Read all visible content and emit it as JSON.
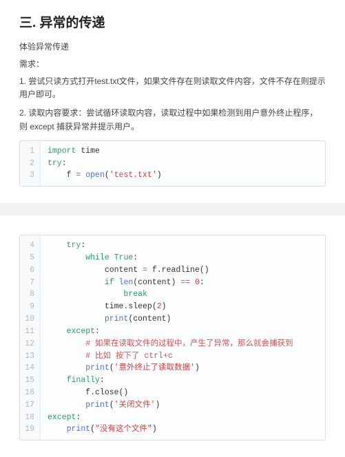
{
  "heading": "三. 异常的传递",
  "intro1": "体验异常传递",
  "intro2": "需求：",
  "req1": "1. 尝试只读方式打开test.txt文件，如果文件存在则读取文件内容，文件不存在则提示用户即可。",
  "req2": "2. 读取内容要求：尝试循环读取内容，读取过程中如果检测到用户意外终止程序，则 except 捕获异常并提示用户。",
  "code1": [
    {
      "n": "1",
      "html": "<span class='kw'>import</span> time"
    },
    {
      "n": "2",
      "html": "<span class='kw'>try</span>:"
    },
    {
      "n": "3",
      "html": "    f <span class='op'>=</span> <span class='fn'>open</span>(<span class='str'>'test.txt'</span>)"
    }
  ],
  "code2": [
    {
      "n": "4",
      "html": "    <span class='kw'>try</span>:"
    },
    {
      "n": "5",
      "html": "        <span class='kw'>while</span> <span class='kw'>True</span>:"
    },
    {
      "n": "6",
      "html": "            content <span class='op'>=</span> f.readline()"
    },
    {
      "n": "7",
      "html": "            <span class='kw'>if</span> <span class='fn'>len</span>(content) <span class='op'>==</span> <span class='num'>0</span>:"
    },
    {
      "n": "8",
      "html": "                <span class='kw'>break</span>"
    },
    {
      "n": "9",
      "html": "            time.sleep(<span class='num'>2</span>)"
    },
    {
      "n": "10",
      "html": "            <span class='fn'>print</span>(content)"
    },
    {
      "n": "11",
      "html": "    <span class='kw'>except</span>:"
    },
    {
      "n": "12",
      "html": "        <span class='cm'># 如果在读取文件的过程中，产生了异常，那么就会捕获到</span>"
    },
    {
      "n": "13",
      "html": "        <span class='cm'># 比如 按下了 ctrl+c</span>"
    },
    {
      "n": "14",
      "html": "        <span class='fn'>print</span>(<span class='str'>'意外终止了读取数据'</span>)"
    },
    {
      "n": "15",
      "html": "    <span class='kw'>finally</span>:"
    },
    {
      "n": "16",
      "html": "        f.close()"
    },
    {
      "n": "17",
      "html": "        <span class='fn'>print</span>(<span class='str'>'关闭文件'</span>)"
    },
    {
      "n": "18",
      "html": "<span class='kw'>except</span>:"
    },
    {
      "n": "19",
      "html": "    <span class='fn'>print</span>(<span class='str'>\"没有这个文件\"</span>)"
    }
  ]
}
